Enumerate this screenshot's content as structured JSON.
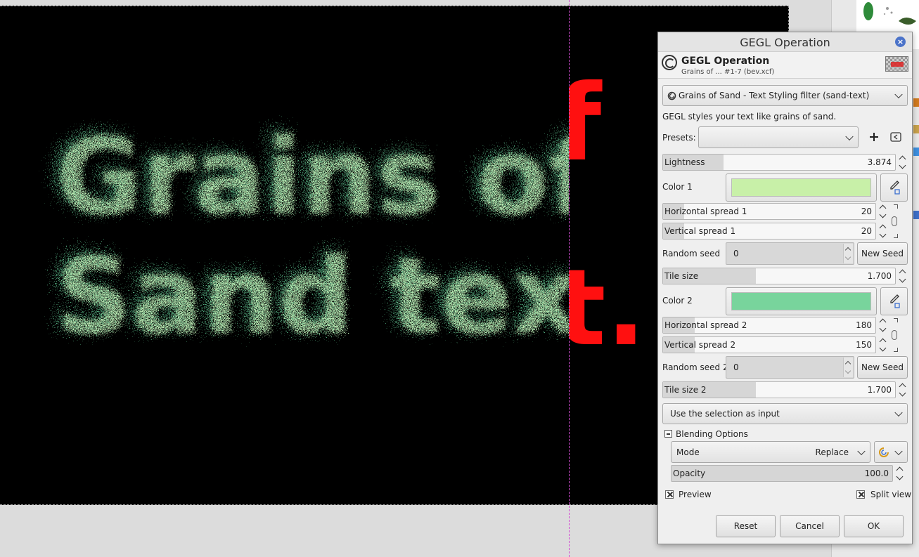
{
  "canvas": {
    "text_line_1": "Grains of",
    "text_line_2": "Sand text",
    "overflow_text_1": "f",
    "overflow_text_2": "t."
  },
  "dialog": {
    "window_title": "GEGL Operation",
    "header_title": "GEGL Operation",
    "header_subtitle": "Grains of ... #1-7 (bev.xcf)",
    "filter_selected": "Grains of Sand - Text Styling filter (sand-text)",
    "description": "GEGL styles your text like grains of sand.",
    "presets_label": "Presets:",
    "presets_value": "",
    "lightness": {
      "label": "Lightness",
      "value": "3.874",
      "fill": 0.26
    },
    "color1": {
      "label": "Color 1",
      "hex": "#c8f0a8"
    },
    "hspread1": {
      "label": "Horizontal spread 1",
      "value": "20",
      "fill": 0.1
    },
    "vspread1": {
      "label": "Vertical spread 1",
      "value": "20",
      "fill": 0.1
    },
    "seed1": {
      "label": "Random seed",
      "value": "0",
      "button": "New Seed"
    },
    "tile_size": {
      "label": "Tile size",
      "value": "1.700",
      "fill": 0.4
    },
    "color2": {
      "label": "Color 2",
      "hex": "#78d49c"
    },
    "hspread2": {
      "label": "Horizontal spread 2",
      "value": "180",
      "fill": 0.15
    },
    "vspread2": {
      "label": "Vertical spread 2",
      "value": "150",
      "fill": 0.15
    },
    "seed2": {
      "label": "Random seed 2",
      "value": "0",
      "button": "New Seed"
    },
    "tile_size2": {
      "label": "Tile size 2",
      "value": "1.700",
      "fill": 0.4
    },
    "input_mode": "Use the selection as input",
    "blending": {
      "label": "Blending Options",
      "mode_label": "Mode",
      "mode_value": "Replace",
      "opacity_label": "Opacity",
      "opacity_value": "100.0",
      "opacity_fill": 1.0
    },
    "preview_label": "Preview",
    "split_view_label": "Split view",
    "buttons": {
      "reset": "Reset",
      "cancel": "Cancel",
      "ok": "OK"
    }
  },
  "colors": {
    "canvas_bg": "#000000",
    "sand_light": "#b8e6b0",
    "sand_dark": "#4fa57a",
    "overflow_red": "#ff1010",
    "guide": "#d24bd2",
    "close_button": "#4b73c9"
  }
}
